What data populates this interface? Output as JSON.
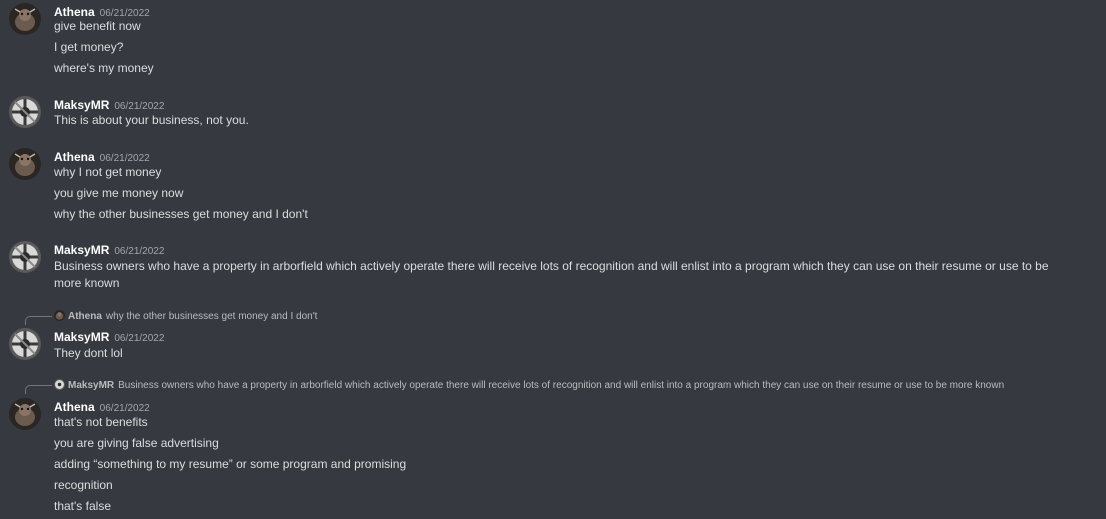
{
  "colors": {
    "background": "#36393f",
    "username": "#ffffff",
    "timestamp": "#a3a6aa",
    "message_text": "#dcddde",
    "reply_text": "#b9bbbe"
  },
  "messages": [
    {
      "author": "Athena",
      "avatar": "athena-avatar",
      "timestamp": "06/21/2022",
      "lines": [
        "give benefit now",
        "I get money?",
        "where's my money"
      ]
    },
    {
      "author": "MaksyMR",
      "avatar": "maksymr-avatar",
      "timestamp": "06/21/2022",
      "lines": [
        "This is about your business, not you."
      ]
    },
    {
      "author": "Athena",
      "avatar": "athena-avatar",
      "timestamp": "06/21/2022",
      "lines": [
        "why I not get money",
        "you give me money now",
        "why the other businesses get money and I don't"
      ]
    },
    {
      "author": "MaksyMR",
      "avatar": "maksymr-avatar",
      "timestamp": "06/21/2022",
      "lines": [
        "Business owners who have a property in arborfield which actively operate there will receive lots of recognition and will enlist into a program which they can use on their resume or use to be more known"
      ]
    },
    {
      "author": "MaksyMR",
      "avatar": "maksymr-avatar",
      "timestamp": "06/21/2022",
      "reply": {
        "author": "Athena",
        "text": "why the other businesses get money and I don't"
      },
      "lines": [
        "They dont lol"
      ]
    },
    {
      "author": "Athena",
      "avatar": "athena-avatar",
      "timestamp": "06/21/2022",
      "reply": {
        "author": "MaksyMR",
        "text": "Business owners who have a property in arborfield which actively operate there will receive lots of recognition and will enlist into a program which they can use on their resume or use to be more known"
      },
      "lines": [
        "that's not benefits",
        "you are giving false advertising",
        "adding “something to my resume” or some program and promising",
        "recognition",
        "that's false"
      ]
    }
  ]
}
